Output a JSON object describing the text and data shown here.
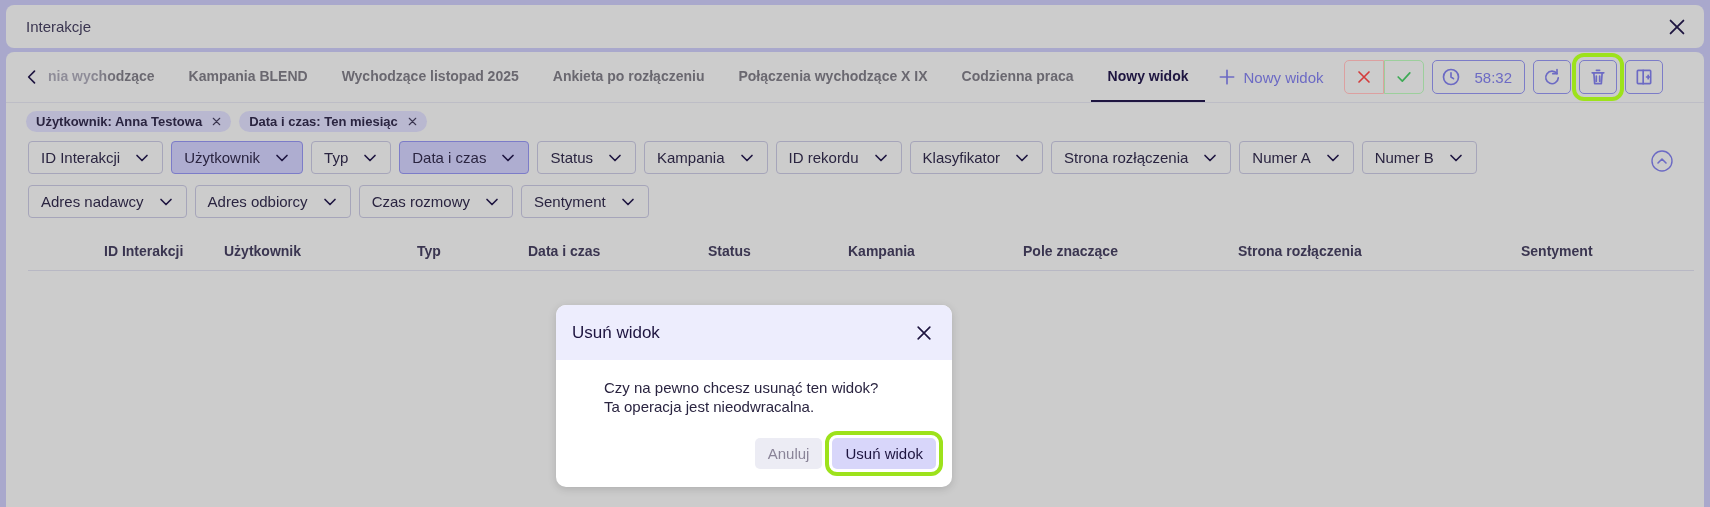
{
  "window": {
    "title": "Interakcje"
  },
  "tabs": [
    {
      "label": "nia wychodzące",
      "selected": false,
      "truncated": true
    },
    {
      "label": "Kampania BLEND",
      "selected": false,
      "truncated": false
    },
    {
      "label": "Wychodzące listopad 2025",
      "selected": false,
      "truncated": false
    },
    {
      "label": "Ankieta po rozłączeniu",
      "selected": false,
      "truncated": false
    },
    {
      "label": "Połączenia wychodzące X IX",
      "selected": false,
      "truncated": false
    },
    {
      "label": "Codzienna praca",
      "selected": false,
      "truncated": false
    },
    {
      "label": "Nowy widok",
      "selected": true,
      "truncated": false
    }
  ],
  "new_tab_button": "Nowy widok",
  "toolbar": [
    {
      "kind": "cancel",
      "highlighted": false
    },
    {
      "kind": "confirm",
      "highlighted": false
    },
    {
      "kind": "timer",
      "label": "58:32",
      "highlighted": false
    },
    {
      "kind": "refresh",
      "highlighted": false
    },
    {
      "kind": "delete",
      "highlighted": true
    },
    {
      "kind": "add-panel",
      "highlighted": false
    }
  ],
  "active_filters": [
    {
      "label": "Użytkownik: Anna Testowa"
    },
    {
      "label": "Data i czas: Ten miesiąc"
    }
  ],
  "filters": [
    {
      "label": "ID Interakcji",
      "active": false
    },
    {
      "label": "Użytkownik",
      "active": true
    },
    {
      "label": "Typ",
      "active": false
    },
    {
      "label": "Data i czas",
      "active": true
    },
    {
      "label": "Status",
      "active": false
    },
    {
      "label": "Kampania",
      "active": false
    },
    {
      "label": "ID rekordu",
      "active": false
    },
    {
      "label": "Klasyfikator",
      "active": false
    },
    {
      "label": "Strona rozłączenia",
      "active": false
    },
    {
      "label": "Numer A",
      "active": false
    },
    {
      "label": "Numer B",
      "active": false
    },
    {
      "label": "Adres nadawcy",
      "active": false
    },
    {
      "label": "Adres odbiorcy",
      "active": false
    },
    {
      "label": "Czas rozmowy",
      "active": false
    },
    {
      "label": "Sentyment",
      "active": false
    }
  ],
  "table": {
    "columns": [
      "ID Interakcji",
      "Użytkownik",
      "Typ",
      "Data i czas",
      "Status",
      "Kampania",
      "Pole znaczące",
      "Strona rozłączenia",
      "Sentyment"
    ]
  },
  "dialog": {
    "title": "Usuń widok",
    "message": [
      "Czy na pewno chcesz usunąć ten widok?",
      "Ta operacja jest nieodwracalna."
    ],
    "buttons": [
      {
        "label": "Anuluj",
        "kind": "secondary",
        "highlighted": false
      },
      {
        "label": "Usuń widok",
        "kind": "primary",
        "highlighted": true
      }
    ]
  }
}
